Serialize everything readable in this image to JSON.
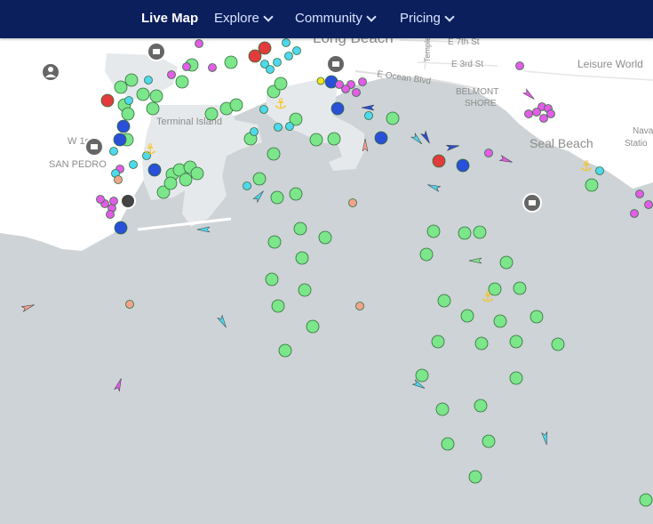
{
  "nav": {
    "live_map": "Live Map",
    "explore": "Explore",
    "community": "Community",
    "pricing": "Pricing"
  },
  "labels": {
    "long_beach": "Long Beach",
    "terminal_island": "Terminal Island",
    "san_pedro": "SAN PEDRO",
    "w1st": "W 1st",
    "e7th": "E 7th St",
    "e3rd": "E 3rd St",
    "e_ocean": "E Ocean Blvd",
    "belmont": "BELMONT",
    "shore": "SHORE",
    "leisure_world": "Leisure World",
    "seal_beach": "Seal Beach",
    "naval": "Nava",
    "naval2": "Statio",
    "temple": "Temple"
  },
  "colors": {
    "navbar": "#0a1f5c",
    "sea": "#cdd3d6",
    "land": "#ffffff",
    "industrial": "#e6e9ec",
    "anchored": "#7ce68a",
    "passenger": "#2a4fd8",
    "tanker": "#e23b3b",
    "pleasure": "#e35be8",
    "tug": "#4fd8ee",
    "other": "#f3a28c",
    "anchorage": "#f7c21c",
    "port_icon": "#666666"
  },
  "icons": [
    "user-icon",
    "port-icon",
    "anchor-icon",
    "ship-arrow-icon"
  ]
}
